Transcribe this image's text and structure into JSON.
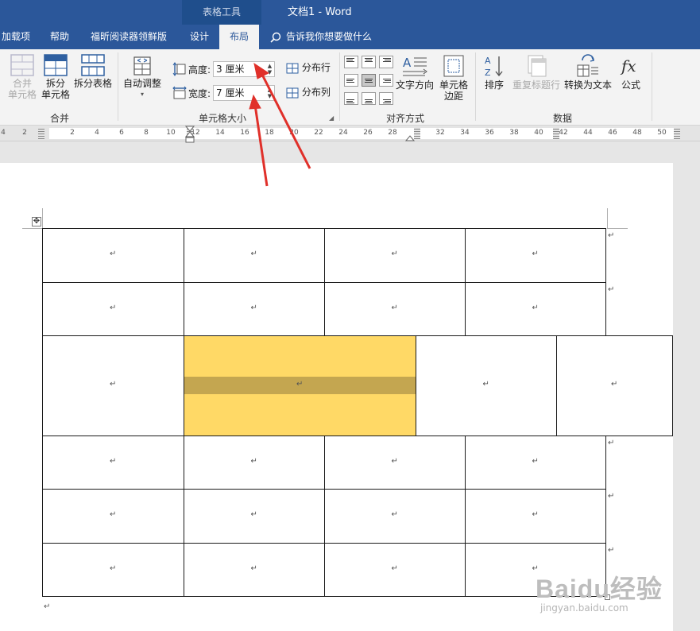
{
  "window": {
    "context_tool": "表格工具",
    "title": "文档1 - Word"
  },
  "tabs": [
    {
      "label": "加载项",
      "active": false
    },
    {
      "label": "帮助",
      "active": false
    },
    {
      "label": "福昕阅读器领鲜版",
      "active": false
    },
    {
      "label": "设计",
      "active": false
    },
    {
      "label": "布局",
      "active": true
    }
  ],
  "tell_me": "告诉我你想要做什么",
  "ribbon": {
    "merge": {
      "label": "合并",
      "merge_cells": "合并\n单元格",
      "split_cells": "拆分\n单元格",
      "split_table": "拆分表格"
    },
    "cell_size": {
      "label": "单元格大小",
      "autofit": "自动调整",
      "height_label": "高度:",
      "height_value": "3 厘米",
      "width_label": "宽度:",
      "width_value": "7 厘米",
      "distribute_rows": "分布行",
      "distribute_cols": "分布列"
    },
    "alignment": {
      "label": "对齐方式",
      "text_direction": "文字方向",
      "cell_margins": "单元格\n边距",
      "active_cell": 4
    },
    "data": {
      "label": "数据",
      "sort": "排序",
      "repeat_header": "重复标题行",
      "convert_to_text": "转换为文本",
      "formula": "公式"
    }
  },
  "ruler": {
    "left_numbers": [
      "4",
      "2"
    ],
    "numbers": [
      "2",
      "4",
      "6",
      "8",
      "10",
      "12",
      "14",
      "16",
      "18",
      "20",
      "22",
      "24",
      "26",
      "28",
      "32",
      "34",
      "36",
      "38",
      "40",
      "42",
      "44",
      "46",
      "48",
      "50"
    ]
  },
  "table": {
    "paragraph_mark": "↵",
    "rows": 6,
    "highlighted_cell": "row 3, column 2"
  },
  "watermark": {
    "brand": "Baidu经验",
    "url": "jingyan.baidu.com"
  },
  "colors": {
    "title_bar": "#2b579a",
    "highlight": "#ffd966",
    "arrow": "#e0302a"
  }
}
